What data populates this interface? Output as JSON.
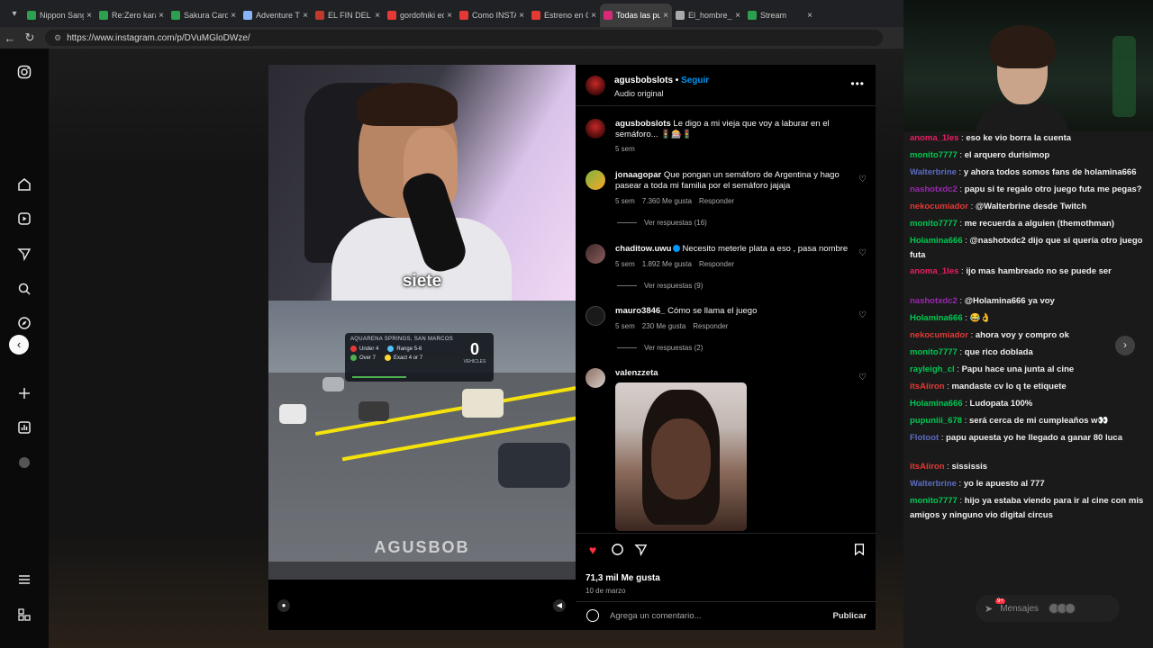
{
  "browser": {
    "tabs": [
      {
        "title": "Nippon Sangoku",
        "color": "#2e9e4f",
        "active": false
      },
      {
        "title": "Re:Zero kara Ha",
        "color": "#2e9e4f",
        "active": false
      },
      {
        "title": "Sakura Card Cap",
        "color": "#2e9e4f",
        "active": false
      },
      {
        "title": "Adventure Time",
        "color": "#8ab4f8",
        "active": false
      },
      {
        "title": "EL FIN DEL PAP",
        "color": "#c0392b",
        "active": false
      },
      {
        "title": "gordofniki eden",
        "color": "#e53935",
        "active": false
      },
      {
        "title": "Como INSTALAR",
        "color": "#e53935",
        "active": false
      },
      {
        "title": "Estreno en Cine",
        "color": "#e53935",
        "active": false
      },
      {
        "title": "Todas las publi",
        "color": "#d62976",
        "active": true
      },
      {
        "title": "El_hombre_pol",
        "color": "#aaaaaa",
        "active": false
      },
      {
        "title": "Stream",
        "color": "#2e9e4f",
        "active": false
      }
    ],
    "url": "https://www.instagram.com/p/DVuMGloDWze/"
  },
  "video": {
    "caption": "siete",
    "watermark": "AGUSBOB",
    "overlay": {
      "location": "AQUARENA SPRINGS, SAN MARCOS",
      "opt1": "Under 4",
      "opt2": "Range 5-6",
      "opt3": "Over 7",
      "opt4": "Exact 4 or 7",
      "count": "0",
      "count_label": "VEHICLES"
    }
  },
  "post": {
    "username": "agusbobslots",
    "follow": "Seguir",
    "audio": "Audio original",
    "comments": [
      {
        "user": "agusbobslots",
        "text": "Le digo a mi vieja que voy a laburar en el semáforo... 🚦🎰🚦",
        "time": "5 sem",
        "likes": "",
        "reply": "",
        "replies": ""
      },
      {
        "user": "jonaagopar",
        "text": "Que pongan un semáforo de Argentina y hago pasear a toda mi familia por el semáforo jajaja",
        "time": "5 sem",
        "likes": "7.360 Me gusta",
        "reply": "Responder",
        "replies": "Ver respuestas (16)"
      },
      {
        "user": "chaditow.uwu",
        "text": "Necesito meterle plata a eso , pasa nombre",
        "time": "5 sem",
        "likes": "1.892 Me gusta",
        "reply": "Responder",
        "replies": "Ver respuestas (9)"
      },
      {
        "user": "mauro3846_",
        "text": "Cómo se llama el juego",
        "time": "5 sem",
        "likes": "230 Me gusta",
        "reply": "Responder",
        "replies": "Ver respuestas (2)"
      },
      {
        "user": "valenzzeta",
        "text": "",
        "time": "",
        "likes": "",
        "reply": "",
        "replies": ""
      }
    ],
    "likes": "71,3 mil Me gusta",
    "date": "10 de marzo",
    "comment_placeholder": "Agrega un comentario...",
    "publish": "Publicar"
  },
  "chat": [
    {
      "user": "anoma_1les",
      "color": "#e91e63",
      "msg": "eso ke vio borra la cuenta"
    },
    {
      "user": "monito7777",
      "color": "#00c853",
      "msg": "el arquero durisimop"
    },
    {
      "user": "Walterbrine",
      "color": "#5c6bc0",
      "msg": "y ahora todos somos fans de holamina666"
    },
    {
      "user": "nashotxdc2",
      "color": "#9c27b0",
      "msg": "papu si te regalo otro juego futa me pegas?"
    },
    {
      "user": "nekocumiador",
      "color": "#e53935",
      "msg": "@Walterbrine desde Twitch"
    },
    {
      "user": "monito7777",
      "color": "#00c853",
      "msg": "me recuerda a alguien (themothman)"
    },
    {
      "user": "Holamina666",
      "color": "#00c853",
      "msg": "@nashotxdc2 dijo que si quería otro juego futa"
    },
    {
      "user": "anoma_1les",
      "color": "#e91e63",
      "msg": "ijo mas hambreado no se puede ser"
    },
    {
      "user": "nashotxdc2",
      "color": "#9c27b0",
      "msg": "@Holamina666 ya voy"
    },
    {
      "user": "Holamina666",
      "color": "#00c853",
      "msg": "😂👌"
    },
    {
      "user": "nekocumiador",
      "color": "#e53935",
      "msg": "ahora voy y compro ok"
    },
    {
      "user": "monito7777",
      "color": "#00c853",
      "msg": "que rico doblada"
    },
    {
      "user": "rayleigh_cl",
      "color": "#00c853",
      "msg": "Papu hace una junta al cine"
    },
    {
      "user": "itsAiiron",
      "color": "#e53935",
      "msg": "mandaste cv lo q te etiquete"
    },
    {
      "user": "Holamina666",
      "color": "#00c853",
      "msg": "Ludopata 100%"
    },
    {
      "user": "pupuniii_678",
      "color": "#00c853",
      "msg": "será cerca de mi cumpleaños w👀"
    },
    {
      "user": "Flotoot",
      "color": "#5c6bc0",
      "msg": "papu apuesta yo he llegado a ganar 80 luca"
    },
    {
      "user": "itsAiiron",
      "color": "#e53935",
      "msg": "sississis"
    },
    {
      "user": "Walterbrine",
      "color": "#5c6bc0",
      "msg": "yo le apuesto al 777"
    },
    {
      "user": "monito7777",
      "color": "#00c853",
      "msg": "hijo ya estaba viendo para ir al cine con mis amigos y ninguno vio digital circus"
    }
  ],
  "messages_pill": {
    "label": "Mensajes",
    "badge": "9+"
  },
  "icons": {
    "heart": "heart-icon",
    "comment": "comment-icon",
    "share": "share-icon",
    "save": "bookmark-icon"
  }
}
